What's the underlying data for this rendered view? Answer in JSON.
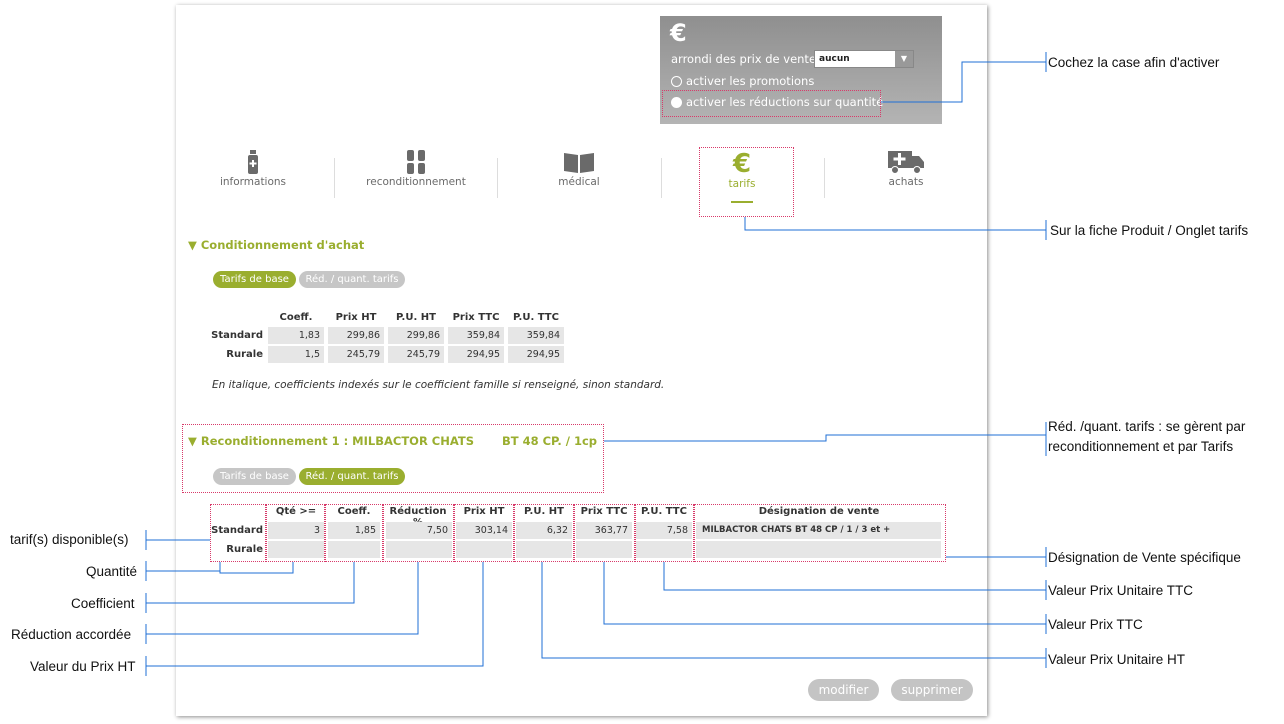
{
  "settings": {
    "euro_symbol": "€",
    "arrondi_label": "arrondi des prix de vente :",
    "arrondi_value": "aucun",
    "promotions_label": "activer les promotions",
    "reductions_label": "activer les réductions sur quantité"
  },
  "tabs": [
    {
      "label": "informations",
      "icon": "bottle-icon"
    },
    {
      "label": "reconditionnement",
      "icon": "bottles-icon"
    },
    {
      "label": "médical",
      "icon": "book-icon"
    },
    {
      "label": "tarifs",
      "icon": "euro-icon",
      "active": true
    },
    {
      "label": "achats",
      "icon": "truck-icon"
    }
  ],
  "conditionnement": {
    "title": "▼ Conditionnement d'achat",
    "pill_base": "Tarifs de base",
    "pill_red": "Réd. / quant. tarifs",
    "headers": [
      "Coeff.",
      "Prix HT",
      "P.U. HT",
      "Prix TTC",
      "P.U. TTC"
    ],
    "rows": [
      {
        "label": "Standard",
        "values": [
          "1,83",
          "299,86",
          "299,86",
          "359,84",
          "359,84"
        ]
      },
      {
        "label": "Rurale",
        "values": [
          "1,5",
          "245,79",
          "245,79",
          "294,95",
          "294,95"
        ]
      }
    ],
    "note": "En italique, coefficients indexés sur le coefficient famille si renseigné, sinon standard."
  },
  "recond": {
    "title": "▼ Reconditionnement 1  :  MILBACTOR CHATS",
    "subtitle": "BT 48 CP. / 1cp",
    "pill_base": "Tarifs de base",
    "pill_red": "Réd. / quant. tarifs",
    "headers": [
      "Qté >=",
      "Coeff.",
      "Réduction %",
      "Prix HT",
      "P.U. HT",
      "Prix TTC",
      "P.U. TTC",
      "Désignation de vente"
    ],
    "rows": [
      {
        "label": "Standard",
        "values": [
          "3",
          "1,85",
          "7,50",
          "303,14",
          "6,32",
          "363,77",
          "7,58",
          "MILBACTOR CHATS  BT 48 CP / 1 / 3 et +"
        ]
      },
      {
        "label": "Rurale",
        "values": [
          "",
          "",
          "",
          "",
          "",
          "",
          "",
          ""
        ]
      }
    ]
  },
  "buttons": {
    "modifier": "modifier",
    "supprimer": "supprimer"
  },
  "callouts": {
    "cochez": "Cochez la case afin d'activer",
    "fiche": "Sur la fiche Produit / Onglet tarifs",
    "red_line1": "Réd. /quant. tarifs : se gèrent par",
    "red_line2": "reconditionnement et par Tarifs",
    "designation": "Désignation de Vente spécifique",
    "pu_ttc": "Valeur Prix Unitaire TTC",
    "prix_ttc": "Valeur Prix TTC",
    "pu_ht": "Valeur Prix Unitaire HT",
    "tarifs_dispo": "tarif(s) disponible(s)",
    "quantite": "Quantité",
    "coefficient": "Coefficient",
    "reduction": "Réduction accordée",
    "prix_ht": "Valeur du Prix HT"
  }
}
